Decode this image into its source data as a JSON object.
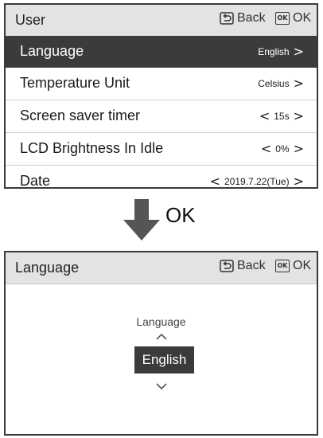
{
  "top_screen": {
    "header": {
      "title": "User",
      "back_label": "Back",
      "ok_label": "OK",
      "ok_icon_text": "OK"
    },
    "menu_items": [
      {
        "label": "Language",
        "value": "English",
        "prefix": "",
        "suffix": ">",
        "selected": true
      },
      {
        "label": "Temperature Unit",
        "value": "Celsius",
        "prefix": "",
        "suffix": ">"
      },
      {
        "label": "Screen saver timer",
        "value": "15s",
        "prefix": "<",
        "suffix": ">"
      },
      {
        "label": "LCD Brightness In Idle",
        "value": "0%",
        "prefix": "<",
        "suffix": ">"
      },
      {
        "label": "Date",
        "value": "2019.7.22(Tue)",
        "prefix": "<",
        "suffix": ">"
      }
    ]
  },
  "transition": {
    "label": "OK"
  },
  "bottom_screen": {
    "header": {
      "title": "Language",
      "back_label": "Back",
      "ok_label": "OK",
      "ok_icon_text": "OK"
    },
    "picker": {
      "label": "Language",
      "up_icon": "chevron-up-icon",
      "selected_value": "English",
      "down_icon": "chevron-down-icon"
    }
  },
  "colors": {
    "header_bg": "#e3e3e3",
    "highlight_bg": "#3b3b3b",
    "arrow": "#555555",
    "border": "#3a3a3a"
  }
}
